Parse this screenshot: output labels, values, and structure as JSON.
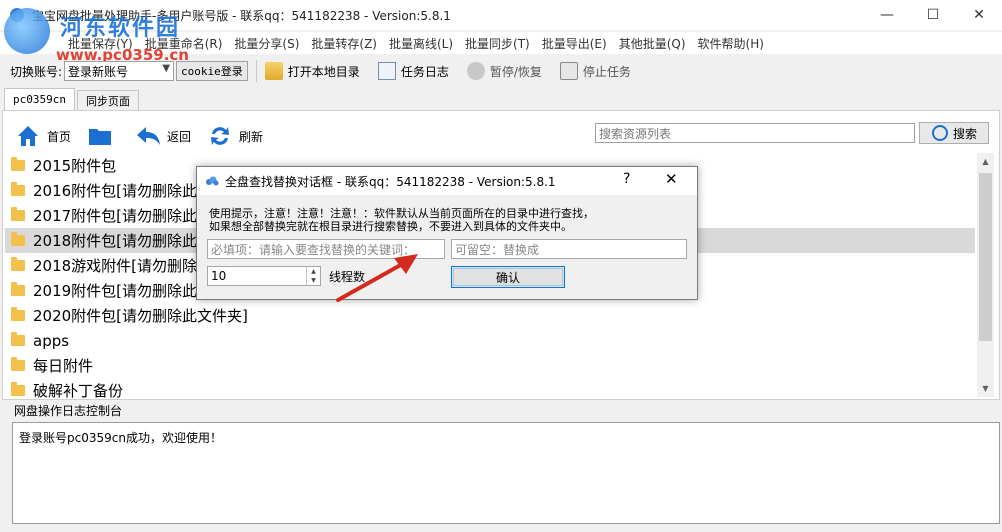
{
  "window": {
    "title": "宝宝网盘批量处理助手-多用户账号版 - 联系qq：541182238 - Version:5.8.1",
    "min_icon": "minimize-icon",
    "max_icon": "maximize-icon",
    "close_icon": "close-icon"
  },
  "watermark": {
    "name": "河东软件园",
    "url": "www.pc0359.cn"
  },
  "menu": {
    "items": [
      "批量保存(Y)",
      "批量重命名(R)",
      "批量分享(S)",
      "批量转存(Z)",
      "批量离线(L)",
      "批量同步(T)",
      "批量导出(E)",
      "其他批量(Q)",
      "软件帮助(H)"
    ]
  },
  "toolbar": {
    "account_label": "切换账号:",
    "account_value": "登录新账号",
    "cookie_button": "cookie登录",
    "open_local": "打开本地目录",
    "task_log": "任务日志",
    "pause_resume": "暂停/恢复",
    "stop_task": "停止任务"
  },
  "tabs": [
    {
      "label": "pc0359cn",
      "active": true
    },
    {
      "label": "同步页面",
      "active": false
    }
  ],
  "nav": {
    "home": "首页",
    "back": "返回",
    "refresh": "刷新"
  },
  "search": {
    "placeholder": "搜索资源列表",
    "button": "搜索"
  },
  "files": [
    {
      "name": "2015附件包",
      "selected": false
    },
    {
      "name": "2016附件包[请勿删除此文件夹]",
      "selected": false
    },
    {
      "name": "2017附件包[请勿删除此文件夹]",
      "selected": false
    },
    {
      "name": "2018附件包[请勿删除此文件夹]",
      "selected": true
    },
    {
      "name": "2018游戏附件[请勿删除此文件夹]",
      "selected": false
    },
    {
      "name": "2019附件包[请勿删除此文件夹]",
      "selected": false
    },
    {
      "name": "2020附件包[请勿删除此文件夹]",
      "selected": false
    },
    {
      "name": "apps",
      "selected": false
    },
    {
      "name": "每日附件",
      "selected": false
    },
    {
      "name": "破解补丁备份",
      "selected": false
    }
  ],
  "log": {
    "title": "网盘操作日志控制台",
    "message": "登录账号pc0359cn成功，欢迎使用！"
  },
  "dialog": {
    "title": "全盘查找替换对话框 - 联系qq：541182238 - Version:5.8.1",
    "help": "?",
    "close": "✕",
    "hint_line1": "使用提示，注意！注意！注意！：软件默认从当前页面所在的目录中进行查找，",
    "hint_line2": "如果想全部替换完就在根目录进行搜索替换，不要进入到具体的文件夹中。",
    "find_placeholder": "必填项：请输入要查找替换的关键词：",
    "replace_placeholder": "可留空：替换成",
    "threads_value": "10",
    "threads_label": "线程数",
    "ok_button": "确认"
  },
  "colors": {
    "accent": "#1a6fd1",
    "arrow": "#d42a1e",
    "selected_row": "#d9d9d9"
  }
}
